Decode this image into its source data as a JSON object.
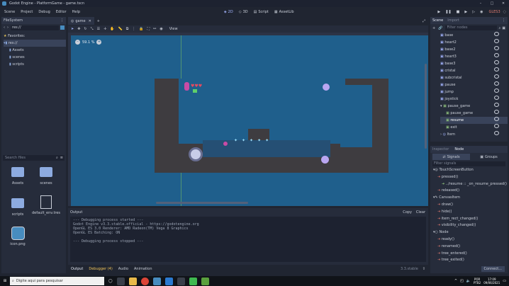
{
  "window": {
    "title": "Godot Engine - PlatformGame - game.tscn"
  },
  "menu": {
    "scene": "Scene",
    "project": "Project",
    "debug": "Debug",
    "editor": "Editor",
    "help": "Help"
  },
  "workspaces": {
    "w2d": "2D",
    "w3d": "3D",
    "script": "Script",
    "assetlib": "AssetLib"
  },
  "renderer": "GLES3",
  "filesystem": {
    "title": "FileSystem",
    "path": "res://",
    "tree": [
      "Favorites:",
      "res://",
      "Assets",
      "scenes",
      "scripts"
    ],
    "search_placeholder": "Search files",
    "grid": [
      {
        "name": "Assets"
      },
      {
        "name": "scenes"
      },
      {
        "name": "scripts"
      },
      {
        "name": "default_env.tres"
      },
      {
        "name": "icon.png"
      }
    ]
  },
  "viewport": {
    "tab": "game",
    "zoom": "59.1 %",
    "view_label": "View"
  },
  "output": {
    "title": "Output",
    "copy": "Copy",
    "clear": "Clear",
    "lines": [
      "--- Debugging process started ---",
      "Godot Engine v3.3.stable.official - https://godotengine.org",
      "OpenGL ES 3.0 Renderer: AMD Radeon(TM) Vega 8 Graphics",
      "OpenGL ES Batching: ON",
      "",
      "--- Debugging process stopped ---"
    ],
    "version": "3.3.stable"
  },
  "bottom_tabs": [
    "Output",
    "Debugger (4)",
    "Audio",
    "Animation"
  ],
  "scene_dock": {
    "tabs": [
      "Scene",
      "Import"
    ],
    "filter_placeholder": "Filter nodes",
    "nodes": [
      {
        "name": "base",
        "indent": 0
      },
      {
        "name": "heart2",
        "indent": 0
      },
      {
        "name": "base2",
        "indent": 0
      },
      {
        "name": "heart3",
        "indent": 0
      },
      {
        "name": "base3",
        "indent": 0
      },
      {
        "name": "cristal",
        "indent": 0
      },
      {
        "name": "subcristal",
        "indent": 0
      },
      {
        "name": "pause",
        "indent": 0
      },
      {
        "name": "jump",
        "indent": 0
      },
      {
        "name": "joystick",
        "indent": 0
      },
      {
        "name": "pause_game",
        "indent": 0
      },
      {
        "name": "pause_game",
        "indent": 1
      },
      {
        "name": "resume",
        "indent": 1
      },
      {
        "name": "exit",
        "indent": 1
      },
      {
        "name": "Item",
        "indent": 0
      }
    ]
  },
  "node_dock": {
    "tabs": [
      "Inspector",
      "Node"
    ],
    "subtabs": [
      "Signals",
      "Groups"
    ],
    "filter_placeholder": "Filter signals",
    "signals": [
      {
        "text": "TouchScreenButton",
        "kind": "header"
      },
      {
        "text": "pressed()",
        "kind": "signal"
      },
      {
        "text": "../resume :: _on_resume_pressed()",
        "kind": "conn"
      },
      {
        "text": "released()",
        "kind": "signal"
      },
      {
        "text": "CanvasItem",
        "kind": "header"
      },
      {
        "text": "draw()",
        "kind": "signal"
      },
      {
        "text": "hide()",
        "kind": "signal"
      },
      {
        "text": "item_rect_changed()",
        "kind": "signal"
      },
      {
        "text": "visibility_changed()",
        "kind": "signal"
      },
      {
        "text": "Node",
        "kind": "header"
      },
      {
        "text": "ready()",
        "kind": "signal"
      },
      {
        "text": "renamed()",
        "kind": "signal"
      },
      {
        "text": "tree_entered()",
        "kind": "signal"
      },
      {
        "text": "tree_exited()",
        "kind": "signal"
      }
    ],
    "connect_label": "Connect..."
  },
  "taskbar": {
    "search_placeholder": "Digite aqui para pesquisar",
    "time": "17:09",
    "date": "09/06/2021",
    "lang": "POR",
    "lang2": "PTB2"
  }
}
